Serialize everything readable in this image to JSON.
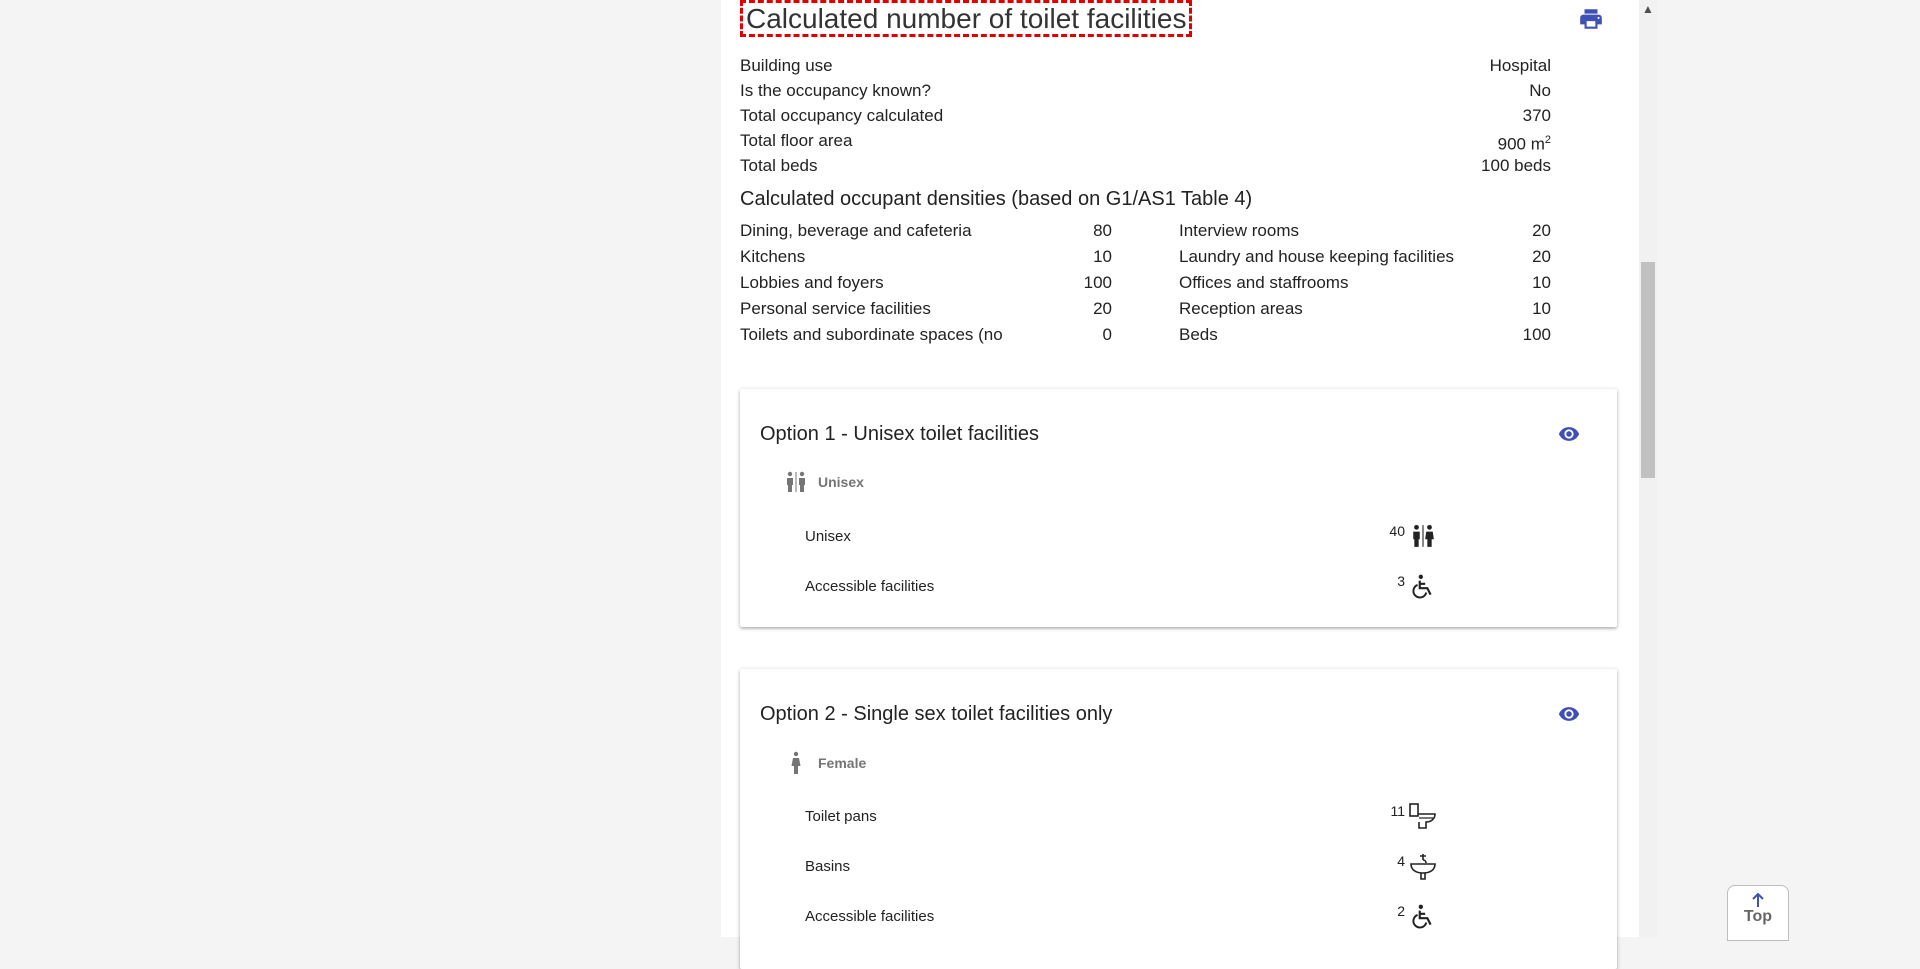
{
  "page": {
    "title": "Calculated number of toilet facilities"
  },
  "summary": [
    {
      "label": "Building use",
      "value": "Hospital"
    },
    {
      "label": "Is the occupancy known?",
      "value": "No"
    },
    {
      "label": "Total occupancy calculated",
      "value": "370"
    },
    {
      "label": "Total floor area",
      "value": "900 m",
      "unit_sup": "2"
    },
    {
      "label": "Total beds",
      "value": "100 beds"
    }
  ],
  "densities": {
    "heading": "Calculated occupant densities (based on G1/AS1 Table 4)",
    "left": [
      {
        "label": "Dining, beverage and cafeteria",
        "value": "80"
      },
      {
        "label": "Kitchens",
        "value": "10"
      },
      {
        "label": "Lobbies and foyers",
        "value": "100"
      },
      {
        "label": "Personal service facilities",
        "value": "20"
      },
      {
        "label": "Toilets and subordinate spaces (no",
        "value": "0"
      }
    ],
    "right": [
      {
        "label": "Interview rooms",
        "value": "20"
      },
      {
        "label": "Laundry and house keeping facilities",
        "value": "20"
      },
      {
        "label": "Offices and staffrooms",
        "value": "10"
      },
      {
        "label": "Reception areas",
        "value": "10"
      },
      {
        "label": "Beds",
        "value": "100"
      }
    ]
  },
  "option1": {
    "title": "Option 1 - Unisex toilet facilities",
    "group": "Unisex",
    "items": [
      {
        "label": "Unisex",
        "count": "40",
        "icon": "unisex-icon"
      },
      {
        "label": "Accessible facilities",
        "count": "3",
        "icon": "wheelchair-icon"
      }
    ]
  },
  "option2": {
    "title": "Option 2 - Single sex toilet facilities only",
    "group": "Female",
    "items": [
      {
        "label": "Toilet pans",
        "count": "11",
        "icon": "toilet-icon"
      },
      {
        "label": "Basins",
        "count": "4",
        "icon": "basin-icon"
      },
      {
        "label": "Accessible facilities",
        "count": "2",
        "icon": "wheelchair-icon"
      }
    ]
  },
  "top_button": {
    "label": "Top"
  },
  "colors": {
    "accent": "#3f51b5",
    "highlight": "#e00000"
  }
}
